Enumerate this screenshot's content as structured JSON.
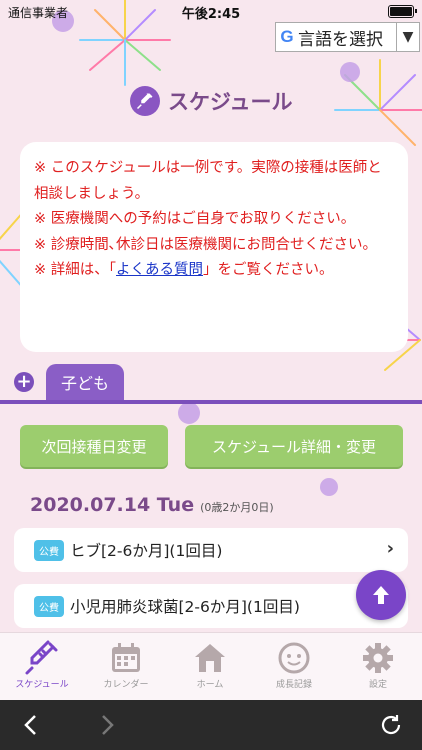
{
  "status_bar": {
    "carrier": "通信事業者",
    "time": "午後2:45"
  },
  "language_selector": {
    "label": "言語を選択",
    "google_letter": "G",
    "arrow": "▼"
  },
  "page": {
    "title": "スケジュール",
    "notice_lines": [
      "※ このスケジュールは一例です。実際の接種は医師と相談しましょう。",
      "※ 医療機関への予約はご自身でお取りください。",
      "※ 診療時間､休診日は医療機関にお問合せください。"
    ],
    "faq_prefix": "※ 詳細は、「",
    "faq_link": "よくある質問",
    "faq_suffix": "」をご覧ください。"
  },
  "child_tab": {
    "plus": "+",
    "label": "子ども"
  },
  "buttons": {
    "next_date": "次回接種日変更",
    "schedule_detail": "スケジュール詳細・変更"
  },
  "schedule": {
    "date": "2020.07.14 Tue",
    "age": "(0歳2か月0日)",
    "items": [
      {
        "badge": "公費",
        "name": "ヒブ[2-6か月](1回目)",
        "chevron": "›"
      },
      {
        "badge": "公費",
        "name": "小児用肺炎球菌[2-6か月](1回目)"
      }
    ]
  },
  "tabbar": {
    "items": [
      {
        "label": "スケジュール",
        "icon": "syringe-icon",
        "active": true
      },
      {
        "label": "カレンダー",
        "icon": "calendar-icon"
      },
      {
        "label": "ホーム",
        "icon": "home-icon"
      },
      {
        "label": "成長記録",
        "icon": "baby-face-icon"
      },
      {
        "label": "設定",
        "icon": "gear-icon"
      }
    ]
  },
  "colors": {
    "accent": "#7a45c8",
    "notice_text": "#e02020",
    "button": "#9ccd6e",
    "badge": "#4fc0e8",
    "title": "#7a4a8a"
  }
}
